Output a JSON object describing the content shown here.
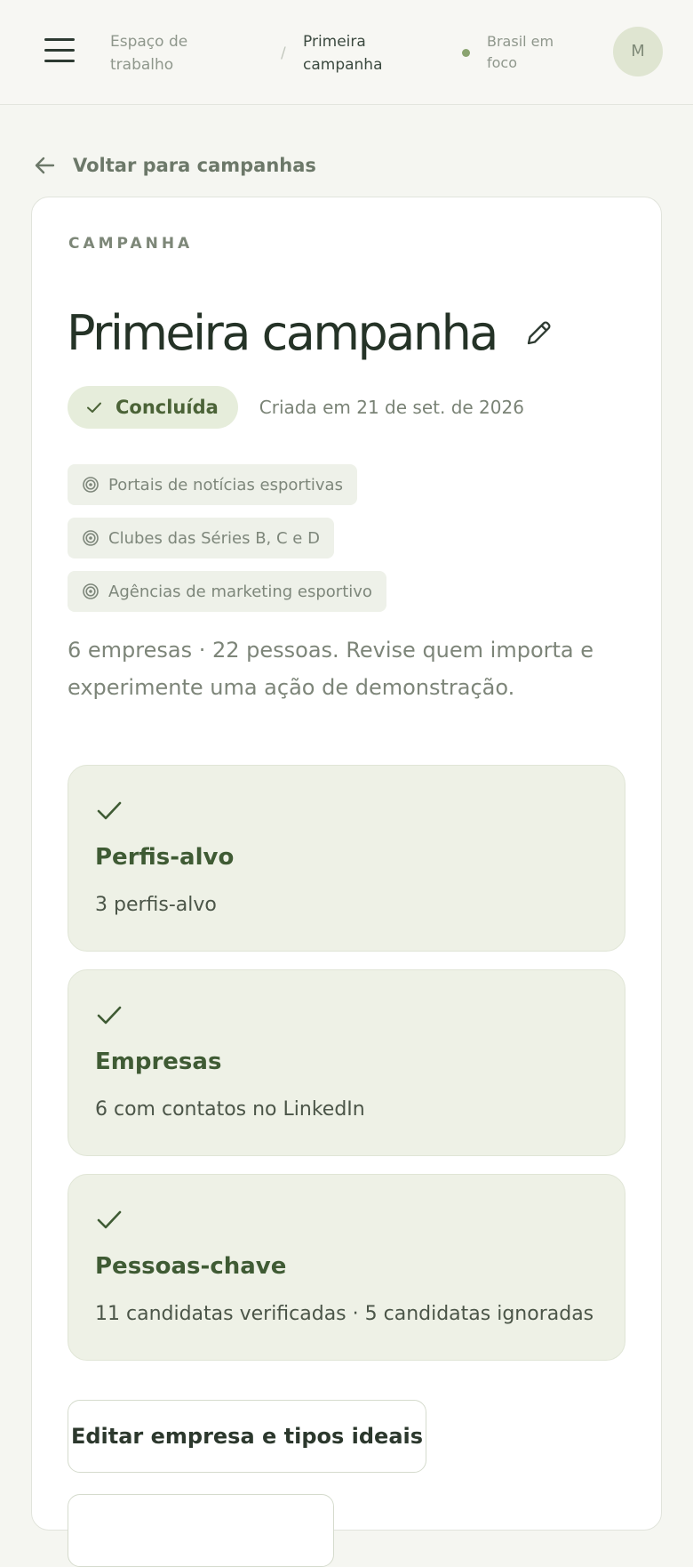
{
  "header": {
    "breadcrumb": {
      "workspace": "Espaço de trabalho",
      "separator": "/",
      "current": "Primeira campanha"
    },
    "workspace_name": "Brasil em foco",
    "avatar_initial": "M"
  },
  "back_link": {
    "label": "Voltar para campanhas"
  },
  "campaign": {
    "eyebrow": "CAMPANHA",
    "title": "Primeira campanha",
    "status": "Concluída",
    "created": "Criada em 21 de set. de 2026",
    "target_profiles": [
      "Portais de notícias esportivas",
      "Clubes das Séries B, C e D",
      "Agências de marketing esportivo"
    ],
    "summary": "6 empresas · 22 pessoas. Revise quem importa e experimente uma ação de demonstração."
  },
  "steps": [
    {
      "title": "Perfis-alvo",
      "description": "3 perfis-alvo",
      "done": true
    },
    {
      "title": "Empresas",
      "description": "6 com contatos no LinkedIn",
      "done": true
    },
    {
      "title": "Pessoas-chave",
      "description": "11 candidatas verificadas · 5 candidatas ignoradas",
      "done": true
    }
  ],
  "actions": {
    "edit_label": "Editar empresa e tipos ideais",
    "second_label": ""
  },
  "colors": {
    "accent_green": "#4b6337",
    "badge_bg": "#e6eddb",
    "step_bg": "#eef1e6",
    "page_bg": "#f5f6f1"
  },
  "icons": {
    "menu": "hamburger-icon",
    "back": "arrow-left-icon",
    "edit": "pencil-icon",
    "status": "check-icon",
    "chip": "target-icon",
    "step": "check-icon"
  }
}
